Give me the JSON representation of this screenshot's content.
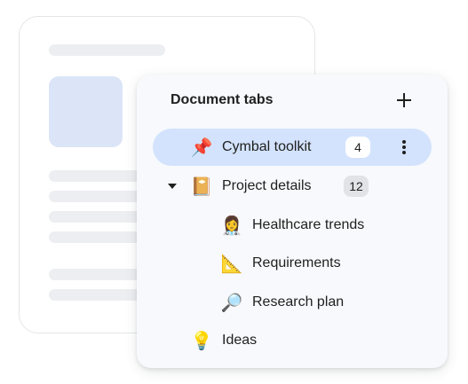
{
  "panel": {
    "title": "Document tabs",
    "add_icon": "plus-icon"
  },
  "tabs": [
    {
      "label": "Cymbal toolkit",
      "emoji": "📌",
      "count": "4",
      "selected": true,
      "menu_icon": "more-vertical-icon"
    },
    {
      "label": "Project details",
      "emoji": "📔",
      "count": "12",
      "expanded": true,
      "toggle_icon": "caret-down-icon"
    },
    {
      "label": "Healthcare trends",
      "emoji": "👩‍⚕️",
      "child": true
    },
    {
      "label": "Requirements",
      "emoji": "📐",
      "child": true
    },
    {
      "label": "Research plan",
      "emoji": "🔎",
      "child": true
    },
    {
      "label": "Ideas",
      "emoji": "💡"
    }
  ],
  "colors": {
    "selected_row": "#d3e3fd",
    "panel_bg": "#f7f9fc",
    "text": "#1f1f1f",
    "placeholder": "#eceef1",
    "thumbnail": "#dbe5f7"
  }
}
